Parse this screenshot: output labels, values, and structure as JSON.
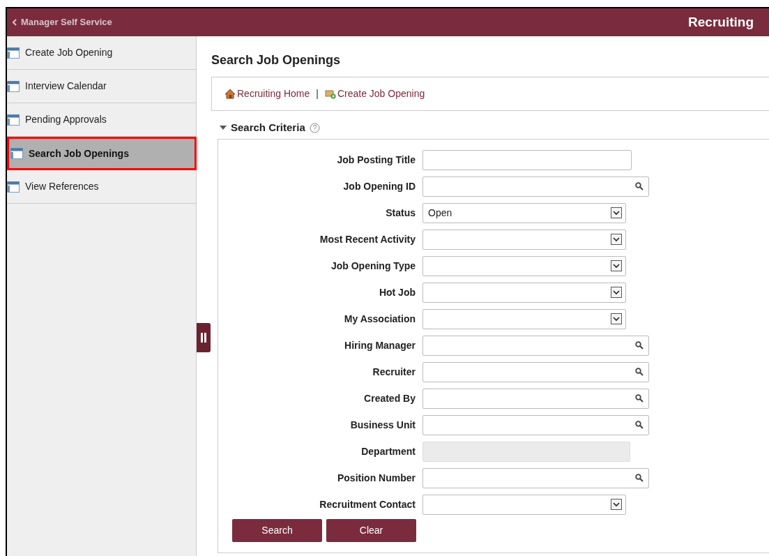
{
  "header": {
    "back_label": "Manager Self Service",
    "title": "Recruiting"
  },
  "sidebar": {
    "items": [
      {
        "label": "Create Job Opening",
        "selected": false
      },
      {
        "label": "Interview Calendar",
        "selected": false
      },
      {
        "label": "Pending Approvals",
        "selected": false
      },
      {
        "label": "Search Job Openings",
        "selected": true
      },
      {
        "label": "View References",
        "selected": false
      }
    ]
  },
  "page_title": "Search Job Openings",
  "links": [
    {
      "kind": "home",
      "label": "Recruiting Home"
    },
    {
      "kind": "create",
      "label": "Create Job Opening"
    }
  ],
  "link_separator": "|",
  "section": {
    "title": "Search Criteria",
    "expanded": true,
    "help_glyph": "?"
  },
  "fields": [
    {
      "label": "Job Posting Title",
      "kind": "text"
    },
    {
      "label": "Job Opening ID",
      "kind": "lookup"
    },
    {
      "label": "Status",
      "kind": "select",
      "value": "Open"
    },
    {
      "label": "Most Recent Activity",
      "kind": "select"
    },
    {
      "label": "Job Opening Type",
      "kind": "select"
    },
    {
      "label": "Hot Job",
      "kind": "select"
    },
    {
      "label": "My Association",
      "kind": "select"
    },
    {
      "label": "Hiring Manager",
      "kind": "lookup"
    },
    {
      "label": "Recruiter",
      "kind": "lookup"
    },
    {
      "label": "Created By",
      "kind": "lookup"
    },
    {
      "label": "Business Unit",
      "kind": "lookup"
    },
    {
      "label": "Department",
      "kind": "disabled"
    },
    {
      "label": "Position Number",
      "kind": "lookup"
    },
    {
      "label": "Recruitment Contact",
      "kind": "select"
    }
  ],
  "buttons": [
    "Search",
    "Clear"
  ]
}
